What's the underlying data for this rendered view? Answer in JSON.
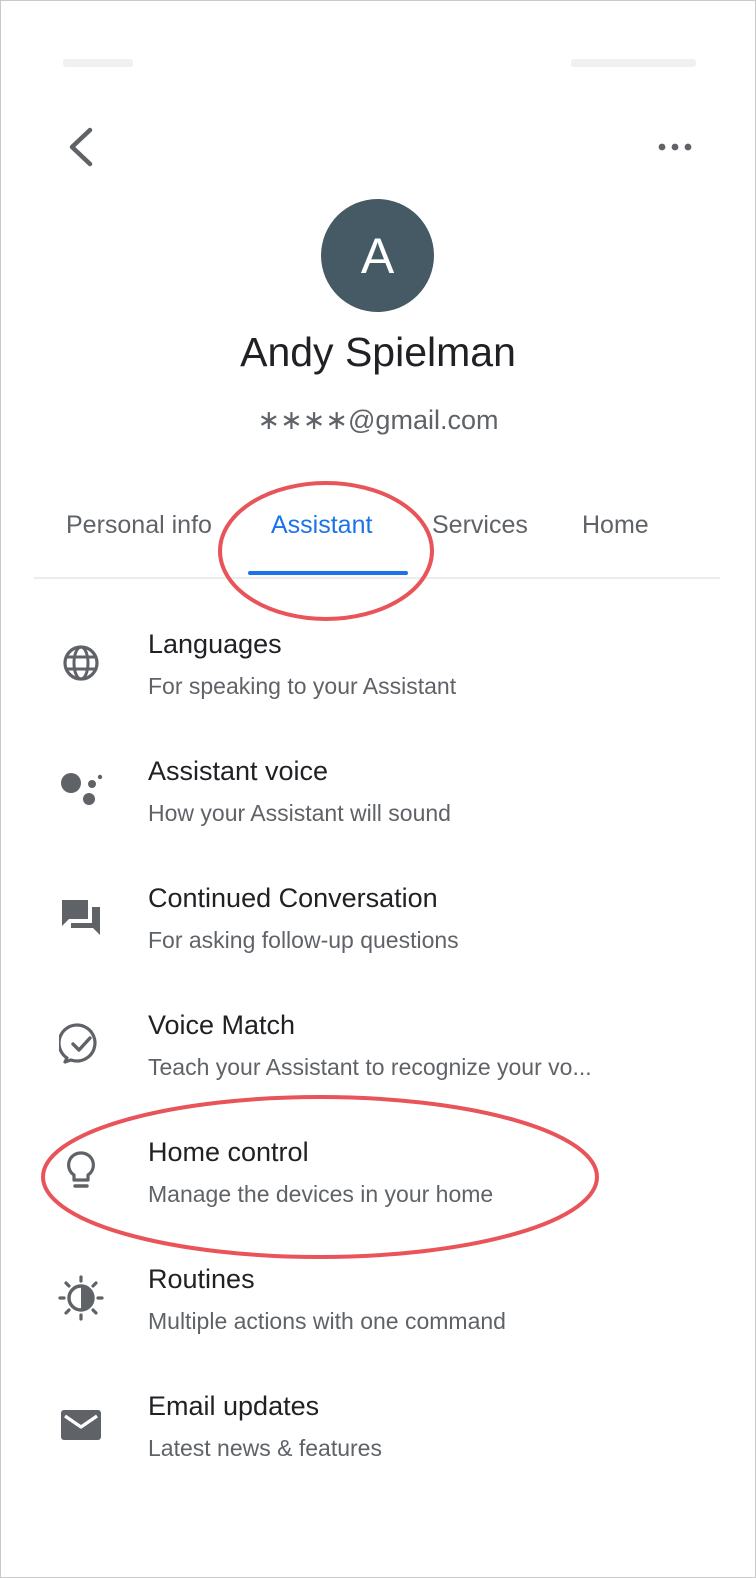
{
  "header": {
    "back_icon": "chevron-left-icon",
    "more_icon": "more-horizontal-icon"
  },
  "profile": {
    "avatar_letter": "A",
    "avatar_color": "#455a64",
    "name": "Andy Spielman",
    "email": "∗∗∗∗@gmail.com"
  },
  "tabs": [
    {
      "label": "Personal info",
      "selected": false
    },
    {
      "label": "Assistant",
      "selected": true
    },
    {
      "label": "Services",
      "selected": false
    },
    {
      "label": "Home",
      "selected": false
    }
  ],
  "accent_color": "#1a73e8",
  "annotation_color": "#e8545a",
  "settings": [
    {
      "icon": "globe-icon",
      "title": "Languages",
      "subtitle": "For speaking to your Assistant"
    },
    {
      "icon": "assistant-dots-icon",
      "title": "Assistant voice",
      "subtitle": "How your Assistant will sound"
    },
    {
      "icon": "chat-bubbles-icon",
      "title": "Continued Conversation",
      "subtitle": "For asking follow-up questions"
    },
    {
      "icon": "voice-match-check-icon",
      "title": "Voice Match",
      "subtitle": "Teach your Assistant to recognize your vo..."
    },
    {
      "icon": "lightbulb-icon",
      "title": "Home control",
      "subtitle": "Manage the devices in your home"
    },
    {
      "icon": "routines-sun-icon",
      "title": "Routines",
      "subtitle": "Multiple actions with one command"
    },
    {
      "icon": "mail-icon",
      "title": "Email updates",
      "subtitle": "Latest news & features"
    }
  ]
}
